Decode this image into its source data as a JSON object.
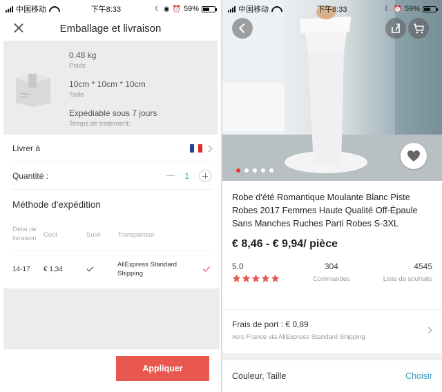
{
  "status": {
    "carrier": "中国移动",
    "time": "下午8:33",
    "battery": "59%",
    "battery_level": 0.59
  },
  "shipping_sheet": {
    "title": "Emballage et livraison",
    "weight_value": "0.48 kg",
    "weight_label": "Poids",
    "size_value": "10cm * 10cm * 10cm",
    "size_label": "Taille",
    "dispatch_value": "Expédiable sous 7 jours",
    "dispatch_label": "Temps de traitement:",
    "deliver_to_label": "Livrer à",
    "deliver_to_flag": "france-flag-icon",
    "quantity_label": "Quantité :",
    "quantity_value": "1",
    "method_title": "Méthode d'expédition",
    "columns": {
      "delay": "Délai de livraison",
      "cost": "Coût",
      "tracking": "Suivi",
      "carrier": "Transporteur"
    },
    "rows": [
      {
        "delay": "14-17",
        "cost": "€ 1,34",
        "tracking": "check-icon",
        "carrier": "AliExpress Standard Shipping",
        "selected": true
      }
    ],
    "apply_button": "Appliquer",
    "accent_color": "#e8584f"
  },
  "product": {
    "title": "Robe d'été Romantique Moulante Blanc Piste Robes 2017 Femmes Haute Qualité Off-Épaule Sans Manches Ruches Parti Robes S-3XL",
    "price": "€ 8,46 - € 9,94/ pièce",
    "rating": "5.0",
    "stars": 5,
    "orders_value": "304",
    "orders_label": "Commandes",
    "wishlist_value": "4545",
    "wishlist_label": "Liste de souhaits",
    "shipping_fee": "Frais de port : € 0,89",
    "shipping_sub": "vers France via AliExpress Standard Shipping",
    "attributes_label": "Couleur, Taille",
    "choose_label": "Choisir",
    "carousel_count": 5,
    "carousel_active": 0,
    "star_color": "#e8584f",
    "link_color": "#3a9bb8"
  }
}
